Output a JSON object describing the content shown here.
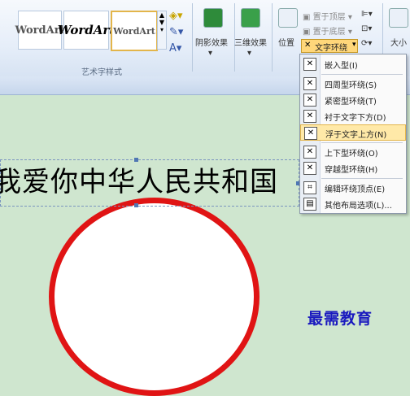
{
  "ribbon": {
    "wordart_styles": [
      "WordArt",
      "WordArt",
      "WordArt"
    ],
    "group_label": "艺术字样式",
    "shadow_effect": "阴影效果",
    "3d_effect": "三维效果",
    "position": "位置",
    "bring_front": "置于顶层",
    "send_back": "置于底层",
    "text_wrap": "文字环绕",
    "size": "大小",
    "accent": "#e3b54a"
  },
  "menu": {
    "items": [
      {
        "label": "嵌入型(I)",
        "icon": "inline-wrap-icon"
      },
      {
        "label": "四周型环绕(S)",
        "icon": "square-wrap-icon"
      },
      {
        "label": "紧密型环绕(T)",
        "icon": "tight-wrap-icon"
      },
      {
        "label": "衬于文字下方(D)",
        "icon": "behind-text-icon"
      },
      {
        "label": "浮于文字上方(N)",
        "icon": "in-front-text-icon"
      },
      {
        "label": "上下型环绕(O)",
        "icon": "top-bottom-wrap-icon"
      },
      {
        "label": "穿越型环绕(H)",
        "icon": "through-wrap-icon"
      },
      {
        "label": "编辑环绕顶点(E)",
        "icon": "edit-wrap-points-icon"
      },
      {
        "label": "其他布局选项(L)...",
        "icon": "more-layout-icon"
      }
    ]
  },
  "document": {
    "wordart_text": "我爱你中华人民共和国",
    "watermark": "最需教育"
  }
}
